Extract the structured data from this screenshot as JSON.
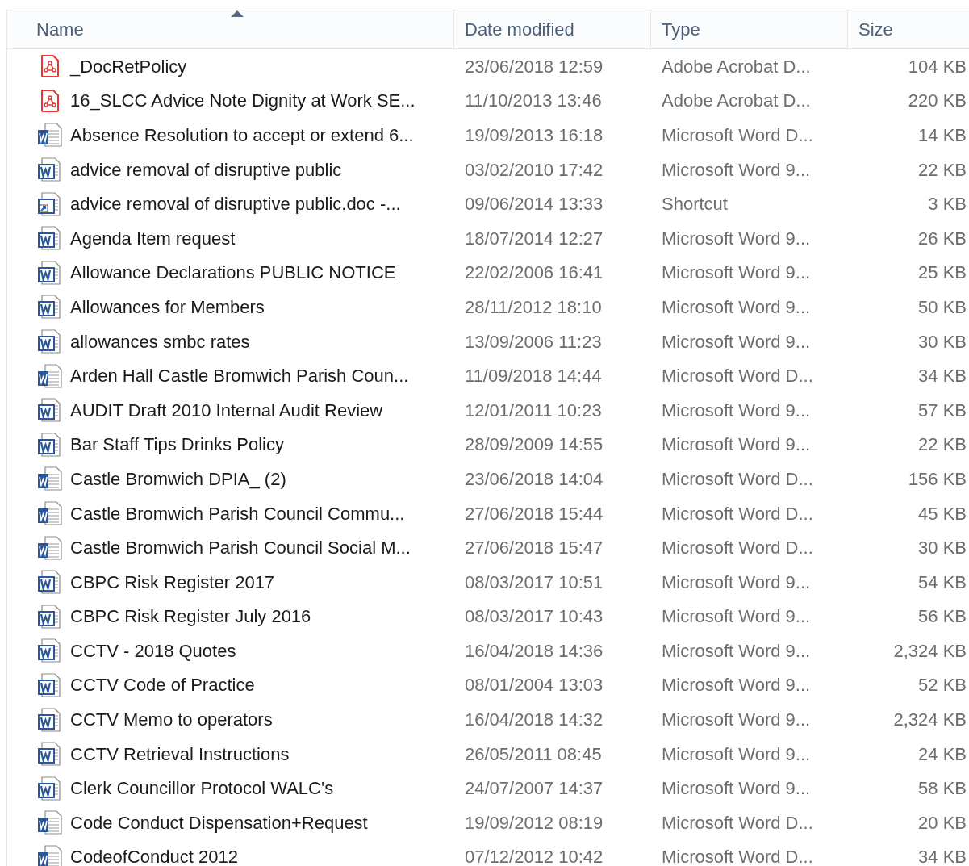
{
  "columns": [
    {
      "label": "Name",
      "sorted": true
    },
    {
      "label": "Date modified",
      "sorted": false
    },
    {
      "label": "Type",
      "sorted": false
    },
    {
      "label": "Size",
      "sorted": false
    }
  ],
  "files": [
    {
      "kind": "pdf",
      "name": "_DocRetPolicy",
      "date": "23/06/2018 12:59",
      "type": "Adobe Acrobat D...",
      "size": "104 KB"
    },
    {
      "kind": "pdf",
      "name": "16_SLCC Advice Note Dignity at Work SE...",
      "date": "11/10/2013 13:46",
      "type": "Adobe Acrobat D...",
      "size": "220 KB"
    },
    {
      "kind": "docx",
      "name": "Absence Resolution to accept or extend 6...",
      "date": "19/09/2013 16:18",
      "type": "Microsoft Word D...",
      "size": "14 KB"
    },
    {
      "kind": "doc",
      "name": "advice removal of disruptive public",
      "date": "03/02/2010 17:42",
      "type": "Microsoft Word 9...",
      "size": "22 KB"
    },
    {
      "kind": "shortcut",
      "name": "advice removal of disruptive public.doc -...",
      "date": "09/06/2014 13:33",
      "type": "Shortcut",
      "size": "3 KB"
    },
    {
      "kind": "doc",
      "name": "Agenda Item request",
      "date": "18/07/2014 12:27",
      "type": "Microsoft Word 9...",
      "size": "26 KB"
    },
    {
      "kind": "doc",
      "name": "Allowance Declarations PUBLIC NOTICE",
      "date": "22/02/2006 16:41",
      "type": "Microsoft Word 9...",
      "size": "25 KB"
    },
    {
      "kind": "doc",
      "name": "Allowances for Members",
      "date": "28/11/2012 18:10",
      "type": "Microsoft Word 9...",
      "size": "50 KB"
    },
    {
      "kind": "doc",
      "name": "allowances smbc rates",
      "date": "13/09/2006 11:23",
      "type": "Microsoft Word 9...",
      "size": "30 KB"
    },
    {
      "kind": "docx",
      "name": "Arden Hall Castle Bromwich Parish Coun...",
      "date": "11/09/2018 14:44",
      "type": "Microsoft Word D...",
      "size": "34 KB"
    },
    {
      "kind": "doc",
      "name": "AUDIT Draft 2010 Internal Audit Review",
      "date": "12/01/2011 10:23",
      "type": "Microsoft Word 9...",
      "size": "57 KB"
    },
    {
      "kind": "doc",
      "name": "Bar Staff Tips Drinks Policy",
      "date": "28/09/2009 14:55",
      "type": "Microsoft Word 9...",
      "size": "22 KB"
    },
    {
      "kind": "docx",
      "name": "Castle Bromwich DPIA_ (2)",
      "date": "23/06/2018 14:04",
      "type": "Microsoft Word D...",
      "size": "156 KB"
    },
    {
      "kind": "docx",
      "name": "Castle Bromwich Parish Council Commu...",
      "date": "27/06/2018 15:44",
      "type": "Microsoft Word D...",
      "size": "45 KB"
    },
    {
      "kind": "docx",
      "name": "Castle Bromwich Parish Council Social M...",
      "date": "27/06/2018 15:47",
      "type": "Microsoft Word D...",
      "size": "30 KB"
    },
    {
      "kind": "doc",
      "name": "CBPC Risk Register 2017",
      "date": "08/03/2017 10:51",
      "type": "Microsoft Word 9...",
      "size": "54 KB"
    },
    {
      "kind": "doc",
      "name": "CBPC Risk Register July 2016",
      "date": "08/03/2017 10:43",
      "type": "Microsoft Word 9...",
      "size": "56 KB"
    },
    {
      "kind": "doc",
      "name": "CCTV - 2018 Quotes",
      "date": "16/04/2018 14:36",
      "type": "Microsoft Word 9...",
      "size": "2,324 KB"
    },
    {
      "kind": "doc",
      "name": "CCTV Code of Practice",
      "date": "08/01/2004 13:03",
      "type": "Microsoft Word 9...",
      "size": "52 KB"
    },
    {
      "kind": "doc",
      "name": "CCTV Memo to operators",
      "date": "16/04/2018 14:32",
      "type": "Microsoft Word 9...",
      "size": "2,324 KB"
    },
    {
      "kind": "doc",
      "name": "CCTV Retrieval Instructions",
      "date": "26/05/2011 08:45",
      "type": "Microsoft Word 9...",
      "size": "24 KB"
    },
    {
      "kind": "doc",
      "name": "Clerk Councillor Protocol WALC's",
      "date": "24/07/2007 14:37",
      "type": "Microsoft Word 9...",
      "size": "58 KB"
    },
    {
      "kind": "docx",
      "name": "Code Conduct Dispensation+Request",
      "date": "19/09/2012 08:19",
      "type": "Microsoft Word D...",
      "size": "20 KB"
    },
    {
      "kind": "docx",
      "name": "CodeofConduct 2012",
      "date": "07/12/2012 10:42",
      "type": "Microsoft Word D...",
      "size": "34 KB"
    }
  ]
}
